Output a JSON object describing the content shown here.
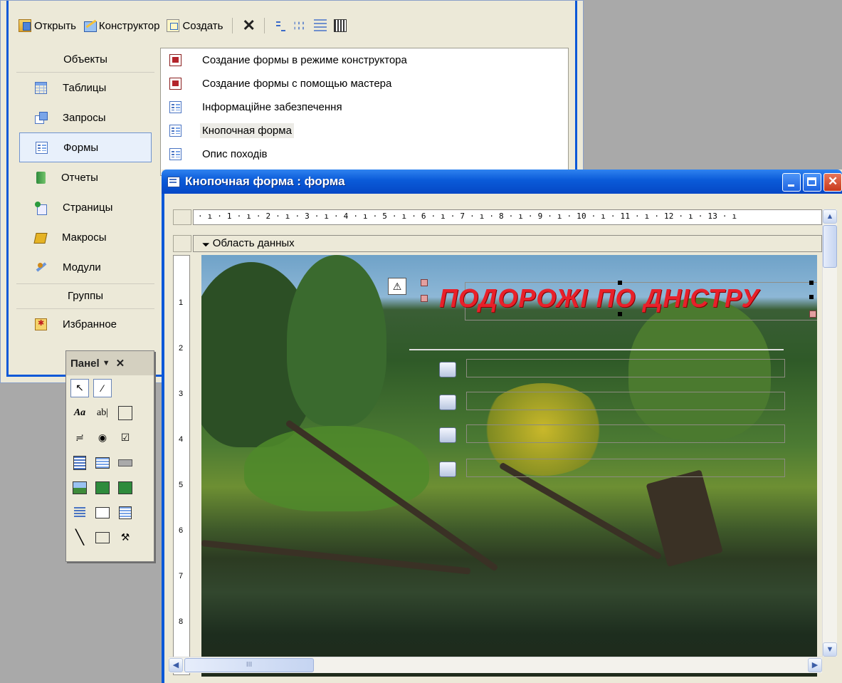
{
  "toolbar": {
    "open_label": "Открыть",
    "design_label": "Конструктор",
    "create_label": "Создать"
  },
  "objects": {
    "header": "Объекты",
    "items": [
      {
        "label": "Таблицы",
        "icon": "table-icon"
      },
      {
        "label": "Запросы",
        "icon": "query-icon"
      },
      {
        "label": "Формы",
        "icon": "form-icon",
        "selected": true
      },
      {
        "label": "Отчеты",
        "icon": "report-icon"
      },
      {
        "label": "Страницы",
        "icon": "page-icon"
      },
      {
        "label": "Макросы",
        "icon": "macro-icon"
      },
      {
        "label": "Модули",
        "icon": "module-icon"
      }
    ],
    "groups_header": "Группы",
    "favorites_label": "Избранное"
  },
  "forms_list": [
    {
      "label": "Создание формы в режиме конструктора",
      "icon": "wizard-icon"
    },
    {
      "label": "Создание формы с помощью мастера",
      "icon": "wizard-icon"
    },
    {
      "label": "Інформаційне забезпечення",
      "icon": "form-icon"
    },
    {
      "label": "Кнопочная форма",
      "icon": "form-icon",
      "focused": true
    },
    {
      "label": "Опис походів",
      "icon": "form-icon"
    }
  ],
  "form_window": {
    "title": "Кнопочная форма : форма",
    "section_label": "Область данных",
    "header_text": "ПОДОРОЖІ ПО ДНІСТРУ",
    "ruler_text": "· ı · 1 · ı · 2 · ı · 3 · ı · 4 · ı · 5 · ı · 6 · ı · 7 · ı · 8 · ı · 9 · ı · 10 · ı · 11 · ı · 12 · ı · 13 · ı",
    "vertical_ruler": [
      "1",
      "2",
      "3",
      "4",
      "5",
      "6",
      "7",
      "8"
    ],
    "menu_buttons_count": 4,
    "hscroll_thumb_label": "III"
  },
  "toolbox": {
    "title": "Панеl",
    "tools": [
      [
        "pointer-tool",
        "wizard-tool"
      ],
      [
        "label-tool",
        "textbox-tool",
        "option-group-tool"
      ],
      [
        "toggle-tool",
        "radio-tool",
        "checkbox-tool"
      ],
      [
        "combobox-tool",
        "listbox-tool",
        "button-tool"
      ],
      [
        "image-tool",
        "unbound-frame-tool",
        "bound-frame-tool"
      ],
      [
        "page-break-tool",
        "tab-tool",
        "subform-tool"
      ],
      [
        "line-tool",
        "rectangle-tool",
        "more-tools-tool"
      ]
    ]
  },
  "colors": {
    "title_bar": "#0a5ad8",
    "header_text": "#e8202a",
    "window_bg": "#ece9d8"
  }
}
